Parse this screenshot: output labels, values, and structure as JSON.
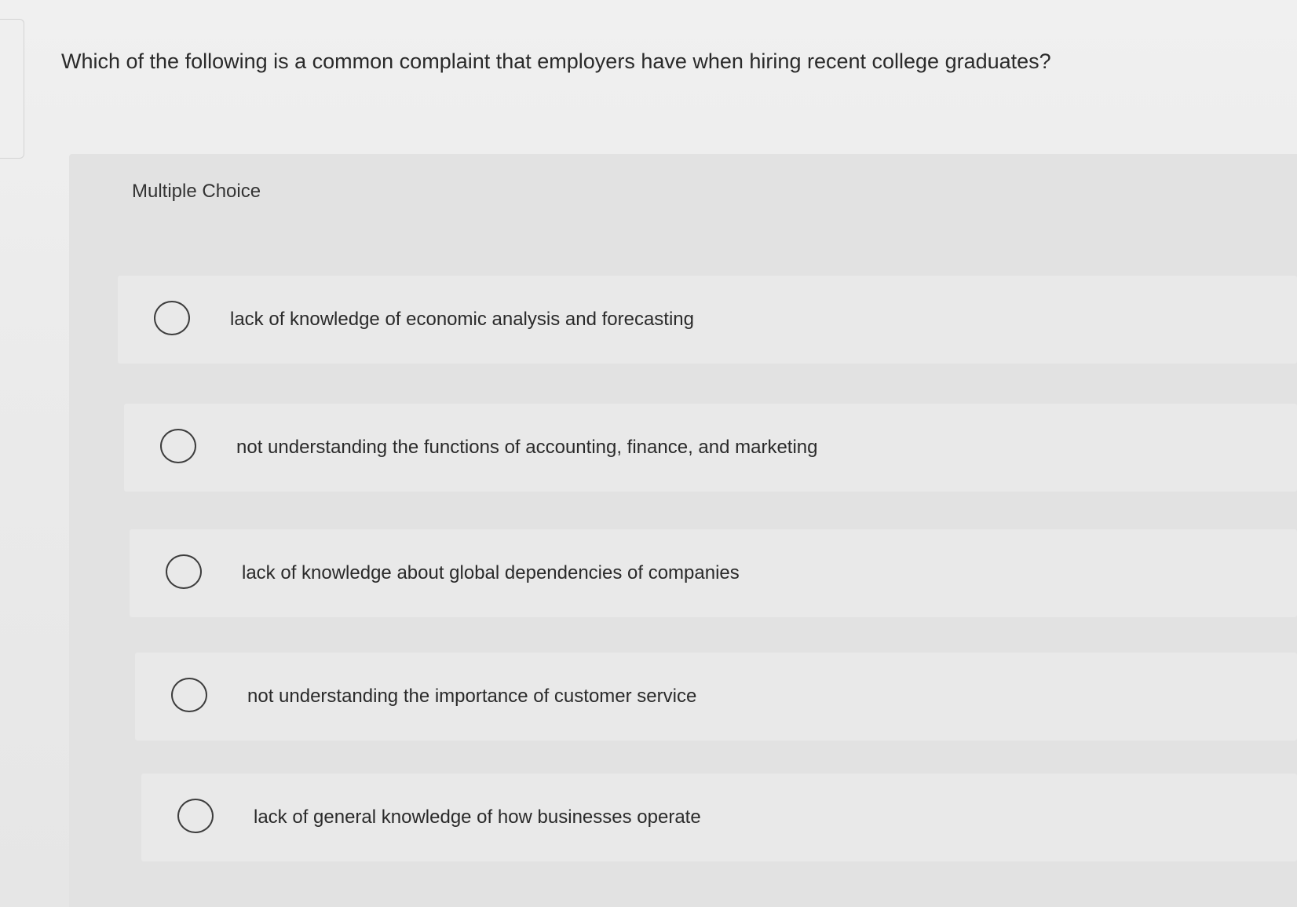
{
  "question": {
    "text": "Which of the following is a common complaint that employers have when hiring recent college graduates?"
  },
  "multiple_choice": {
    "label": "Multiple Choice",
    "options": [
      {
        "label": "lack of knowledge of economic analysis and forecasting",
        "selected": false
      },
      {
        "label": "not understanding the functions of accounting, finance, and marketing",
        "selected": false
      },
      {
        "label": "lack of knowledge about global dependencies of companies",
        "selected": false
      },
      {
        "label": "not understanding the importance of customer service",
        "selected": false
      },
      {
        "label": "lack of general knowledge of how businesses operate",
        "selected": false
      }
    ]
  },
  "colors": {
    "background": "#ececec",
    "panel": "#e2e2e2",
    "option": "#e9e9e9",
    "text": "#2a2a2a",
    "radio_border": "#3d3d3d"
  }
}
